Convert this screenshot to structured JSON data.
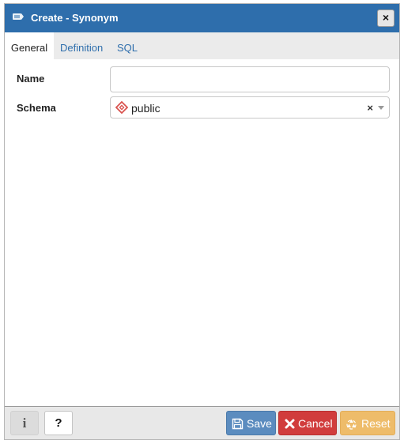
{
  "dialog": {
    "title": "Create - Synonym",
    "close_label": "×"
  },
  "tabs": [
    {
      "label": "General",
      "active": true
    },
    {
      "label": "Definition",
      "active": false
    },
    {
      "label": "SQL",
      "active": false
    }
  ],
  "form": {
    "name_label": "Name",
    "name_value": "",
    "schema_label": "Schema",
    "schema_value": "public",
    "schema_clear": "×"
  },
  "footer": {
    "info_label": "i",
    "help_label": "?",
    "save_label": "Save",
    "cancel_label": "Cancel",
    "reset_label": "Reset"
  },
  "icons": {
    "title": "synonym-icon",
    "schema": "schema-icon",
    "save": "floppy-disk-icon",
    "cancel": "x-icon",
    "reset": "recycle-icon"
  },
  "colors": {
    "titlebar": "#2e6eac",
    "tab_link": "#2e6eac",
    "save": "#5b8cbf",
    "cancel": "#d13c3c",
    "reset": "#eebc6a",
    "schema_icon": "#d9534f"
  }
}
